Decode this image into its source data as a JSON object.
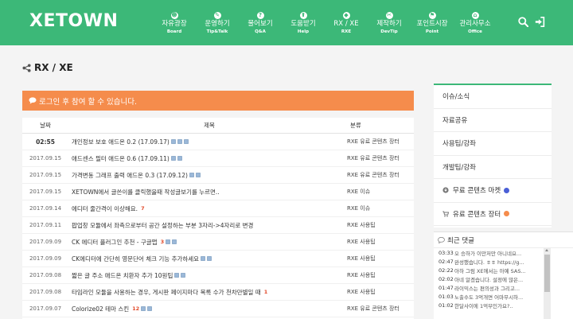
{
  "header": {
    "logo": "XETOWN",
    "nav": [
      {
        "label": "자유광장",
        "sub": "Board",
        "icon": "users-icon",
        "glyph": "☻"
      },
      {
        "label": "운영하기",
        "sub": "Tip&Talk",
        "icon": "chat-icon",
        "glyph": "✎"
      },
      {
        "label": "물어보기",
        "sub": "Q&A",
        "icon": "question-icon",
        "glyph": "?"
      },
      {
        "label": "도움받기",
        "sub": "Help",
        "icon": "help-icon",
        "glyph": "⬆"
      },
      {
        "label": "RX / XE",
        "sub": "RXE",
        "icon": "cube-icon",
        "glyph": "◆"
      },
      {
        "label": "제작하기",
        "sub": "DevTip",
        "icon": "code-icon",
        "glyph": "✂"
      },
      {
        "label": "포인트시장",
        "sub": "Point",
        "icon": "cart-icon",
        "glyph": "⚑"
      },
      {
        "label": "관리사무소",
        "sub": "Office",
        "icon": "office-icon",
        "glyph": "⌂"
      }
    ]
  },
  "page": {
    "title": "RX / XE",
    "alert": "로그인 후 참여 할 수 있습니다."
  },
  "board": {
    "columns": {
      "date": "날짜",
      "title": "제목",
      "category": "분류"
    },
    "rows": [
      {
        "date": "02:55",
        "recent": true,
        "title": "개인정보 보호 애드온 0.2 (17.09.17)",
        "comments": "",
        "files": 3,
        "category": "RXE 유료 콘텐츠 장터"
      },
      {
        "date": "2017.09.15",
        "recent": false,
        "title": "애드센스 필터 애드온 0.6 (17.09.11)",
        "comments": "",
        "files": 2,
        "category": "RXE 유료 콘텐츠 장터"
      },
      {
        "date": "2017.09.15",
        "recent": false,
        "title": "가격변동 그래프 출력 애드온 0.3 (17.09.12)",
        "comments": "",
        "files": 2,
        "category": "RXE 유료 콘텐츠 장터"
      },
      {
        "date": "2017.09.15",
        "recent": false,
        "title": "XETOWN에서 글쓴이를 클릭했을때 작성글보기를 누르면..",
        "comments": "",
        "files": 0,
        "category": "RXE 이슈"
      },
      {
        "date": "2017.09.14",
        "recent": false,
        "title": "에디터 줄간격이 이상해요.",
        "comments": "7",
        "files": 0,
        "category": "RXE 이슈"
      },
      {
        "date": "2017.09.11",
        "recent": false,
        "title": "팝업창 모듈에서 좌측으로부터 공간 설정하는 부분 3자리->4자리로 변경",
        "comments": "",
        "files": 0,
        "category": "RXE 사용팁"
      },
      {
        "date": "2017.09.09",
        "recent": false,
        "title": "CK 에디터 플러그인 추천 - 구글맵",
        "comments": "3",
        "files": 2,
        "category": "RXE 사용팁"
      },
      {
        "date": "2017.09.09",
        "recent": false,
        "title": "CK에디터에 간단히 영문단어 체크 기능 추가하세요",
        "comments": "",
        "files": 2,
        "category": "RXE 사용팁"
      },
      {
        "date": "2017.09.08",
        "recent": false,
        "title": "짧은 글 주소 애드온 치환자 추가 10원팁",
        "comments": "",
        "files": 2,
        "category": "RXE 사용팁"
      },
      {
        "date": "2017.09.08",
        "recent": false,
        "title": "타임라인 모듈을 사용하는 경우, 게시판 페이지마다 목록 수가 천차만별일 때",
        "comments": "1",
        "files": 0,
        "category": "RXE 사용팁"
      },
      {
        "date": "2017.09.07",
        "recent": false,
        "title": "Colorize02 테마 스킨",
        "comments": "12",
        "files": 2,
        "category": "RXE 유료 콘텐츠 장터"
      }
    ]
  },
  "sidebar": {
    "items": [
      {
        "label": "이슈/소식",
        "icon": ""
      },
      {
        "label": "자료공유",
        "icon": ""
      },
      {
        "label": "사용팁/강좌",
        "icon": ""
      },
      {
        "label": "개발팁/강좌",
        "icon": ""
      },
      {
        "label": "무료 콘텐츠 마켓",
        "icon": "download-icon",
        "badge": "new"
      },
      {
        "label": "유료 콘텐츠 장터",
        "icon": "cart-icon",
        "badge": "hot"
      }
    ]
  },
  "comments": {
    "title": "최근 댓글",
    "items": [
      {
        "time": "03:33",
        "text": "오 승하가 이만저만 아니네요..."
      },
      {
        "time": "02:47",
        "text": "완성했습니다. ㅎㅎ https://g..."
      },
      {
        "time": "02:22",
        "text": "아하 그럼 XE에서는 아예 SAS..."
      },
      {
        "time": "02:02",
        "text": "아네 알겠습니다. 설정에 많은..."
      },
      {
        "time": "01:47",
        "text": "라이믹스는 편의성과 그리고..."
      },
      {
        "time": "01:03",
        "text": "노출수도 3억개면 어마무시하..."
      },
      {
        "time": "01:02",
        "text": "한달사이에 1억부인가요?.."
      }
    ]
  },
  "colors": {
    "brand": "#3cb878",
    "alert": "#f58c4c",
    "new_badge": "#4a5fd6",
    "hot_badge": "#f58c4c"
  }
}
